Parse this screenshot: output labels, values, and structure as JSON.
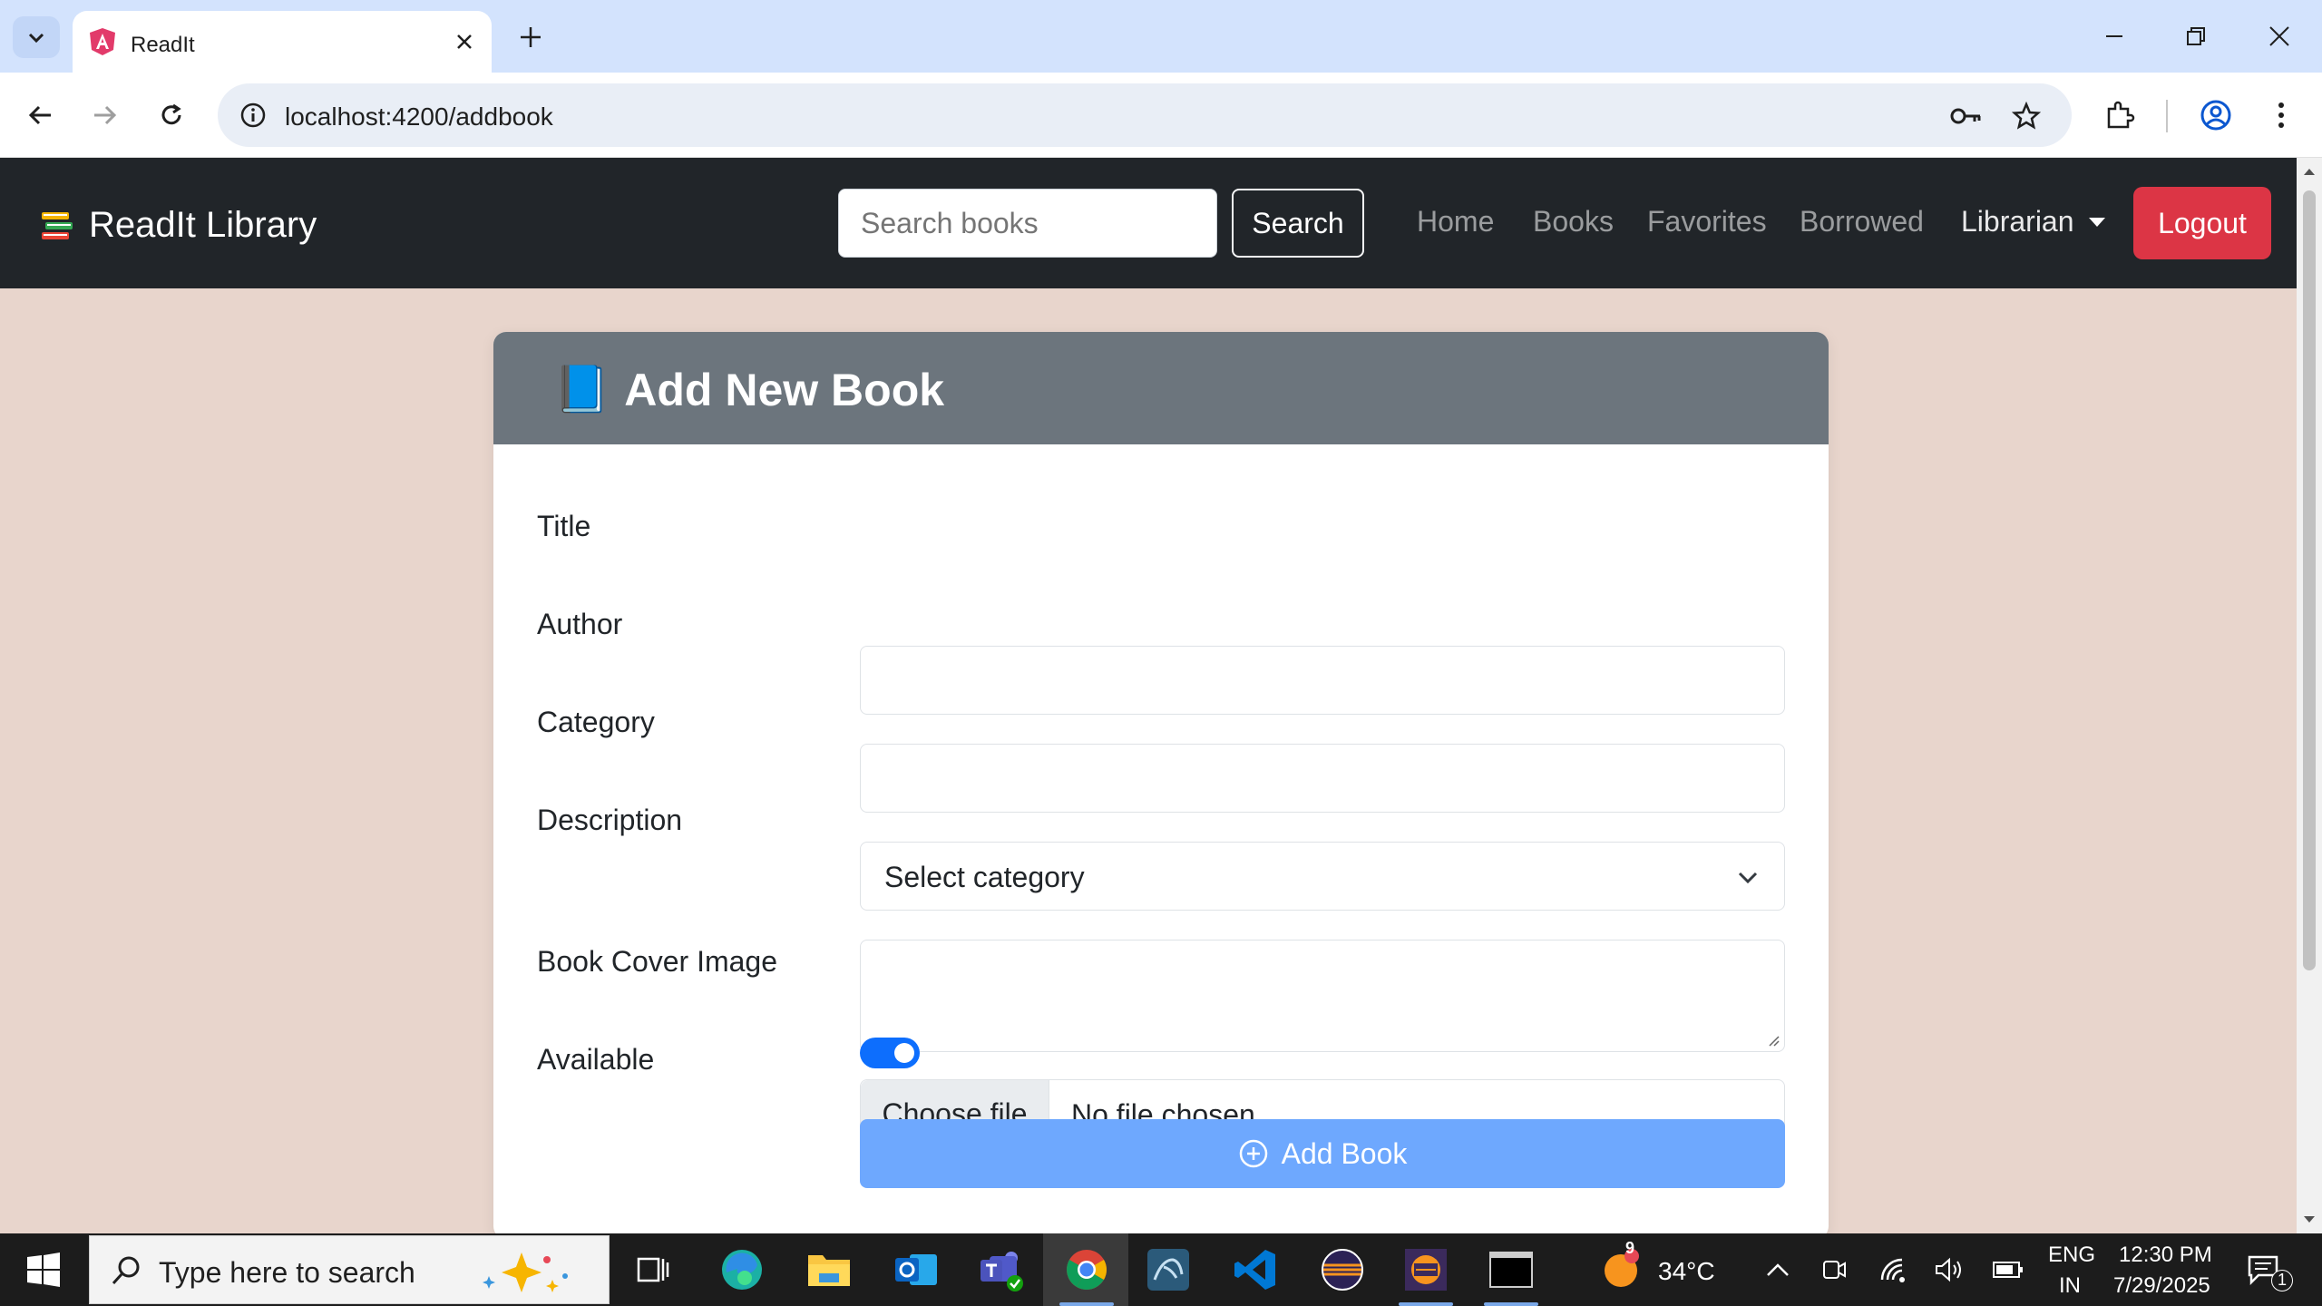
{
  "browser": {
    "tab_title": "ReadIt",
    "url": "localhost:4200/addbook"
  },
  "navbar": {
    "brand": "ReadIt Library",
    "search_placeholder": "Search books",
    "search_button": "Search",
    "links": [
      "Home",
      "Books",
      "Favorites",
      "Borrowed"
    ],
    "dropdown_label": "Librarian",
    "logout_label": "Logout"
  },
  "form": {
    "header_icon": "📘",
    "title": "Add New Book",
    "labels": {
      "title": "Title",
      "author": "Author",
      "category": "Category",
      "description": "Description",
      "cover": "Book Cover Image",
      "available": "Available"
    },
    "values": {
      "title": "",
      "author": "",
      "category": "Select category",
      "description": "",
      "available": true
    },
    "file_button": "Choose file",
    "file_status": "No file chosen",
    "submit_label": "Add Book"
  },
  "taskbar": {
    "search_placeholder": "Type here to search",
    "weather_temp": "34°C",
    "weather_badge": "9",
    "lang_line1": "ENG",
    "lang_line2": "IN",
    "time": "12:30 PM",
    "date": "7/29/2025",
    "notification_count": "1"
  },
  "colors": {
    "navbar_bg": "#212529",
    "page_bg": "#e8d5cc",
    "card_header_bg": "#6c757d",
    "logout_bg": "#dc3545",
    "submit_bg": "#6ea8fe",
    "switch_on": "#0d6efd"
  }
}
